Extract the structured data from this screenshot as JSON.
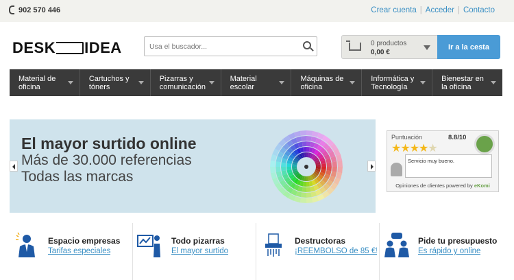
{
  "topbar": {
    "phone": "902 570 446",
    "links": [
      "Crear cuenta",
      "Acceder",
      "Contacto"
    ]
  },
  "header": {
    "logo_left": "DESK",
    "logo_right": "IDEA",
    "search_placeholder": "Usa el buscador...",
    "cart_products": "0 productos",
    "cart_total": "0,00 €",
    "basket_button": "Ir a la cesta"
  },
  "nav": {
    "items": [
      [
        "Material de",
        "oficina"
      ],
      [
        "Cartuchos y",
        "tóners"
      ],
      [
        "Pizarras y",
        "comunicación"
      ],
      [
        "Material",
        "escolar"
      ],
      [
        "Máquinas de",
        "oficina"
      ],
      [
        "Informática y",
        "Tecnología"
      ],
      [
        "Bienestar en",
        "la oficina"
      ]
    ]
  },
  "banner": {
    "line1": "El mayor surtido online",
    "line2": "Más de 30.000 referencias",
    "line3": "Todas las marcas"
  },
  "rating": {
    "label": "Puntuación",
    "score": "8.8/10",
    "stars": 4.5,
    "review": "Servicio muy bueno.",
    "footer_prefix": "Opiniones de clientes powered by",
    "footer_brand": "eKomi"
  },
  "features": [
    {
      "title": "Espacio empresas",
      "link": "Tarifas especiales",
      "icon": "business-person-icon"
    },
    {
      "title": "Todo pizarras",
      "link": "El mayor surtido",
      "icon": "whiteboard-presenter-icon"
    },
    {
      "title": "Destructoras",
      "link": "¡REEMBOLSO de 85 €!",
      "icon": "paper-shredder-icon"
    },
    {
      "title": "Pide tu presupuesto",
      "link": "Es rápido y online",
      "icon": "people-chat-icon"
    }
  ],
  "colors": {
    "accent": "#4a9bd6",
    "nav_bg": "#3a3a3a",
    "banner_bg": "#cfe3ec",
    "link": "#3a8fc4"
  }
}
